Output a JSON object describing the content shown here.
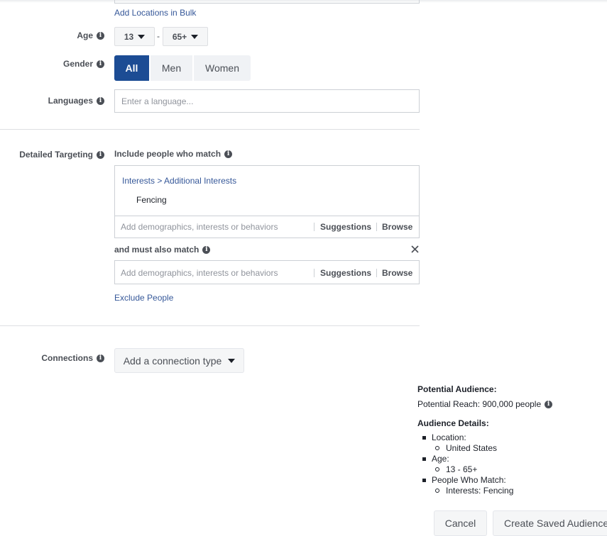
{
  "location": {
    "bulk_link": "Add Locations in Bulk"
  },
  "age": {
    "label": "Age",
    "min": "13",
    "separator": "-",
    "max": "65+"
  },
  "gender": {
    "label": "Gender",
    "options": [
      "All",
      "Men",
      "Women"
    ],
    "selected": "All"
  },
  "languages": {
    "label": "Languages",
    "placeholder": "Enter a language..."
  },
  "detailed_targeting": {
    "label": "Detailed Targeting",
    "include_label": "Include people who match",
    "breadcrumb": "Interests > Additional Interests",
    "selected_interest": "Fencing",
    "input_placeholder": "Add demographics, interests or behaviors",
    "suggestions": "Suggestions",
    "browse": "Browse",
    "narrow_label": "and must also match",
    "exclude_link": "Exclude People"
  },
  "connections": {
    "label": "Connections",
    "button": "Add a connection type"
  },
  "summary": {
    "potential_audience_title": "Potential Audience:",
    "potential_reach": "Potential Reach: 900,000 people",
    "details_title": "Audience Details:",
    "details": [
      {
        "label": "Location:",
        "value": "United States"
      },
      {
        "label": "Age:",
        "value": "13 - 65+"
      },
      {
        "label": "People Who Match:",
        "value": "Interests: Fencing"
      }
    ]
  },
  "footer": {
    "cancel": "Cancel",
    "create": "Create Saved Audience"
  },
  "colors": {
    "primary": "#1c4c94",
    "link": "#365899",
    "border": "#ccd0d5"
  }
}
